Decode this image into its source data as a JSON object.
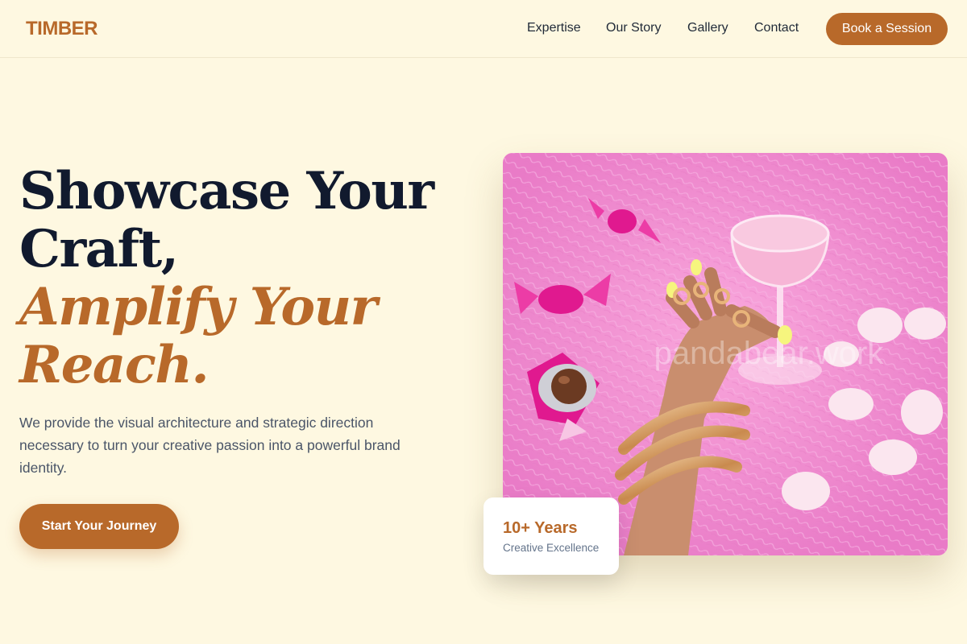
{
  "brand": {
    "logo_text": "TIMBER"
  },
  "nav": {
    "links": [
      "Expertise",
      "Our Story",
      "Gallery",
      "Contact"
    ],
    "cta_label": "Book a Session"
  },
  "hero": {
    "headline_line1": "Showcase Your",
    "headline_line2": "Craft,",
    "headline_accent1": "Amplify Your",
    "headline_accent2": "Reach.",
    "description": "We provide the visual architecture and strategic direction necessary to turn your creative passion into a powerful brand identity.",
    "cta_label": "Start Your Journey"
  },
  "stat_card": {
    "value": "10+ Years",
    "label": "Creative Excellence"
  },
  "image": {
    "watermark": "pandabear.work"
  },
  "colors": {
    "background": "#fef8e1",
    "accent": "#b8692a",
    "heading": "#111a2e",
    "body_text": "#4a5568",
    "photo_background": "#f08fd0"
  }
}
